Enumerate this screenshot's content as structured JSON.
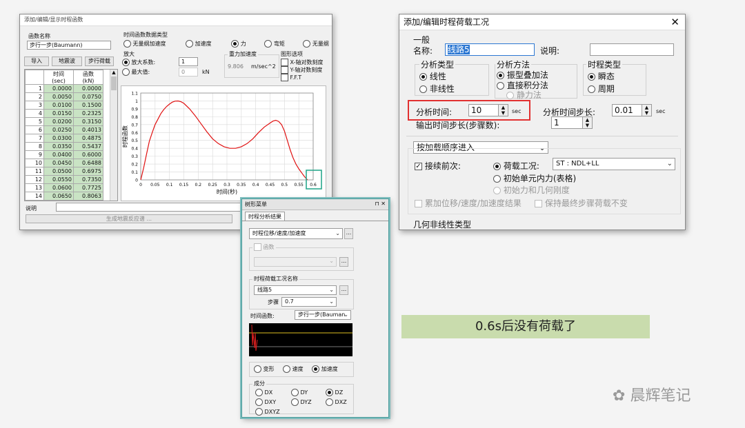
{
  "left_dialog": {
    "title": "添加/编辑/显示时程函数",
    "fn_name_label": "函数名称",
    "fn_name_value": "步行一步(Baumann)",
    "buttons": [
      "导入",
      "地震波",
      "步行荷载"
    ],
    "table_headers": [
      [
        "时间",
        "(sec)"
      ],
      [
        "函数",
        "(kN)"
      ]
    ],
    "rows": [
      [
        "1",
        "0.0000",
        "0.0000"
      ],
      [
        "2",
        "0.0050",
        "0.0750"
      ],
      [
        "3",
        "0.0100",
        "0.1500"
      ],
      [
        "4",
        "0.0150",
        "0.2325"
      ],
      [
        "5",
        "0.0200",
        "0.3150"
      ],
      [
        "6",
        "0.0250",
        "0.4013"
      ],
      [
        "7",
        "0.0300",
        "0.4875"
      ],
      [
        "8",
        "0.0350",
        "0.5437"
      ],
      [
        "9",
        "0.0400",
        "0.6000"
      ],
      [
        "10",
        "0.0450",
        "0.6488"
      ],
      [
        "11",
        "0.0500",
        "0.6975"
      ],
      [
        "12",
        "0.0550",
        "0.7350"
      ],
      [
        "13",
        "0.0600",
        "0.7725"
      ],
      [
        "14",
        "0.0650",
        "0.8063"
      ]
    ],
    "data_type_group": "时间函数数据类型",
    "data_types": [
      "无量纲加速度",
      "加速度",
      "力",
      "弯矩",
      "无量纲"
    ],
    "selected_data_type": "力",
    "amplify_group": "放大",
    "amp_factor_label": "放大系数:",
    "amp_factor_value": "1",
    "max_label": "最大值:",
    "max_value": "0",
    "max_unit": "kN",
    "gravity_group": "重力加速度",
    "gravity_value": "9.806",
    "gravity_unit": "m/sec^2",
    "graph_group": "图形选项",
    "graph_options": [
      "X-轴对数刻度",
      "Y-轴对数刻度",
      "F.F.T"
    ],
    "desc_label": "说明",
    "gen_button": "生成地震反应谱 ..."
  },
  "chart_data": {
    "type": "line",
    "xlabel": "时间(秒)",
    "ylabel": "时程函数",
    "xlim": [
      0,
      0.6
    ],
    "ylim": [
      0,
      1.1
    ],
    "xticks": [
      "0",
      "0.05",
      "0.1",
      "0.15",
      "0.2",
      "0.25",
      "0.3",
      "0.35",
      "0.4",
      "0.45",
      "0.5",
      "0.55",
      "0.6"
    ],
    "yticks": [
      "0",
      "0.1",
      "0.2",
      "0.3",
      "0.4",
      "0.5",
      "0.6",
      "0.7",
      "0.8",
      "0.9",
      "1",
      "1.1"
    ],
    "highlight_tick": "0.6",
    "x": [
      0,
      0.01,
      0.02,
      0.03,
      0.04,
      0.05,
      0.06,
      0.07,
      0.08,
      0.09,
      0.1,
      0.11,
      0.12,
      0.13,
      0.14,
      0.15,
      0.17,
      0.19,
      0.21,
      0.23,
      0.25,
      0.27,
      0.29,
      0.31,
      0.33,
      0.35,
      0.37,
      0.39,
      0.41,
      0.43,
      0.45,
      0.46,
      0.47,
      0.48,
      0.49,
      0.5,
      0.51,
      0.52,
      0.53,
      0.54,
      0.55,
      0.56,
      0.57,
      0.58
    ],
    "y": [
      0,
      0.15,
      0.32,
      0.49,
      0.6,
      0.7,
      0.77,
      0.84,
      0.89,
      0.93,
      0.96,
      0.985,
      0.998,
      1.0,
      0.99,
      0.97,
      0.9,
      0.81,
      0.71,
      0.61,
      0.52,
      0.46,
      0.42,
      0.4,
      0.4,
      0.42,
      0.46,
      0.52,
      0.6,
      0.67,
      0.72,
      0.745,
      0.755,
      0.74,
      0.7,
      0.62,
      0.5,
      0.38,
      0.28,
      0.2,
      0.14,
      0.09,
      0.04,
      0.0
    ]
  },
  "graph_menu": {
    "title": "树形菜单",
    "pin": "⊓ ✕",
    "tab": "时程分析结果",
    "result_type": "时程位移/速度/加速度",
    "fn_check_label": "函数",
    "load_case_group": "时程荷载工况名称",
    "load_case_value": "线路5",
    "step_label": "步骤",
    "step_value": "0.7",
    "time_fn_label": "时间函数:",
    "time_fn_value": "步行一步(Bauman",
    "mode_options": [
      "变形",
      "速度",
      "加速度"
    ],
    "mode_selected": "加速度",
    "component_group": "成分",
    "components": [
      "DX",
      "DY",
      "DZ",
      "DXY",
      "DYZ",
      "DXZ",
      "DXYZ"
    ],
    "component_selected": "DZ"
  },
  "right_dialog": {
    "title": "添加/编辑时程荷载工况",
    "general_label": "一般",
    "name_label": "名称:",
    "name_value": "线路5",
    "desc_label": "说明:",
    "analysis_type_group": "分析类型",
    "analysis_types": [
      "线性",
      "非线性"
    ],
    "analysis_type_selected": "线性",
    "method_group": "分析方法",
    "methods": [
      "振型叠加法",
      "直接积分法",
      "静力法"
    ],
    "method_selected": "振型叠加法",
    "history_type_group": "时程类型",
    "history_types": [
      "瞬态",
      "周期"
    ],
    "history_type_selected": "瞬态",
    "end_time_label": "分析时间:",
    "end_time_value": "10",
    "end_time_unit": "sec",
    "step_label": "分析时间步长:",
    "step_value": "0.01",
    "step_unit": "sec",
    "output_step_label": "输出时间步长(步骤数):",
    "output_step_value": "1",
    "order_value": "按加载顺序进入",
    "continue_label": "接续前次:",
    "continue_checked": true,
    "load_case_label": "荷载工况:",
    "load_case_value": "ST : NDL+LL",
    "init_force_label": "初始单元内力(表格)",
    "init_stiff_label": "初始力和几何刚度",
    "accum_label": "累加位移/速度/加速度结果",
    "keep_label": "保持最终步骤荷载不变",
    "geom_label": "几何非线性类型"
  },
  "annotation": {
    "text": "0.6s后没有荷载了",
    "bg": "#c9dcad"
  },
  "watermark": "晨辉笔记",
  "colors": {
    "highlight_red": "#e23030",
    "highlight_teal": "#2aa88e",
    "curve": "#e01010",
    "table_green": "#c9e3c4",
    "accent_blue": "#2a76d2"
  }
}
